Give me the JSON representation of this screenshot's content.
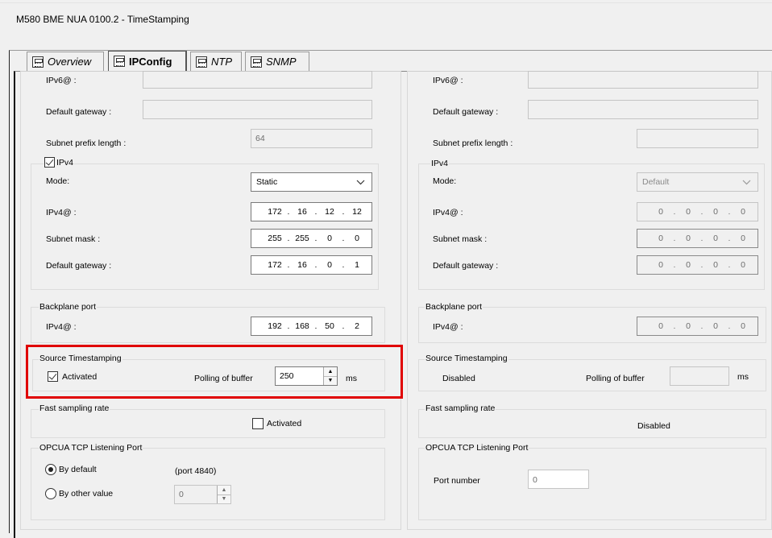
{
  "window": {
    "title": "M580 BME NUA 0100.2 - TimeStamping"
  },
  "tabs": [
    {
      "label": "Overview",
      "icon": "module-icon"
    },
    {
      "label": "IPConfig",
      "icon": "module-icon"
    },
    {
      "label": "NTP",
      "icon": "module-icon"
    },
    {
      "label": "SNMP",
      "icon": "module-icon"
    }
  ],
  "left": {
    "ipv6": {
      "address_label": "IPv6@ :",
      "gateway_label": "Default gateway :",
      "prefix_label": "Subnet prefix length :",
      "prefix_value": "64"
    },
    "ipv4": {
      "group_label": "IPv4",
      "mode_label": "Mode:",
      "mode_value": "Static",
      "address_label": "IPv4@ :",
      "address": [
        "172",
        "16",
        "12",
        "12"
      ],
      "mask_label": "Subnet mask :",
      "mask": [
        "255",
        "255",
        "0",
        "0"
      ],
      "gateway_label": "Default gateway :",
      "gateway": [
        "172",
        "16",
        "0",
        "1"
      ]
    },
    "backplane": {
      "group_label": "Backplane port",
      "address_label": "IPv4@ :",
      "address": [
        "192",
        "168",
        "50",
        "2"
      ]
    },
    "timestamping": {
      "group_label": "Source Timestamping",
      "activated_label": "Activated",
      "polling_label": "Polling of buffer",
      "polling_value": "250",
      "unit": "ms"
    },
    "fast_sampling": {
      "group_label": "Fast sampling rate",
      "activated_label": "Activated"
    },
    "opcua": {
      "group_label": "OPCUA TCP Listening Port",
      "default_label": "By default",
      "default_port": "(port 4840)",
      "other_label": "By other value",
      "other_value": "0"
    }
  },
  "right": {
    "ipv6": {
      "address_label": "IPv6@ :",
      "gateway_label": "Default gateway :",
      "prefix_label": "Subnet prefix length :"
    },
    "ipv4": {
      "group_label": "IPv4",
      "mode_label": "Mode:",
      "mode_value": "Default",
      "address_label": "IPv4@ :",
      "address": [
        "0",
        "0",
        "0",
        "0"
      ],
      "mask_label": "Subnet mask :",
      "mask": [
        "0",
        "0",
        "0",
        "0"
      ],
      "gateway_label": "Default gateway :",
      "gateway": [
        "0",
        "0",
        "0",
        "0"
      ]
    },
    "backplane": {
      "group_label": "Backplane port",
      "address_label": "IPv4@ :",
      "address": [
        "0",
        "0",
        "0",
        "0"
      ]
    },
    "timestamping": {
      "group_label": "Source Timestamping",
      "status": "Disabled",
      "polling_label": "Polling of buffer",
      "unit": "ms"
    },
    "fast_sampling": {
      "group_label": "Fast sampling rate",
      "status": "Disabled"
    },
    "opcua": {
      "group_label": "OPCUA TCP Listening Port",
      "port_label": "Port number",
      "port_value": "0"
    }
  },
  "colors": {
    "highlight": "#e00000",
    "background": "#f0f0f0"
  }
}
